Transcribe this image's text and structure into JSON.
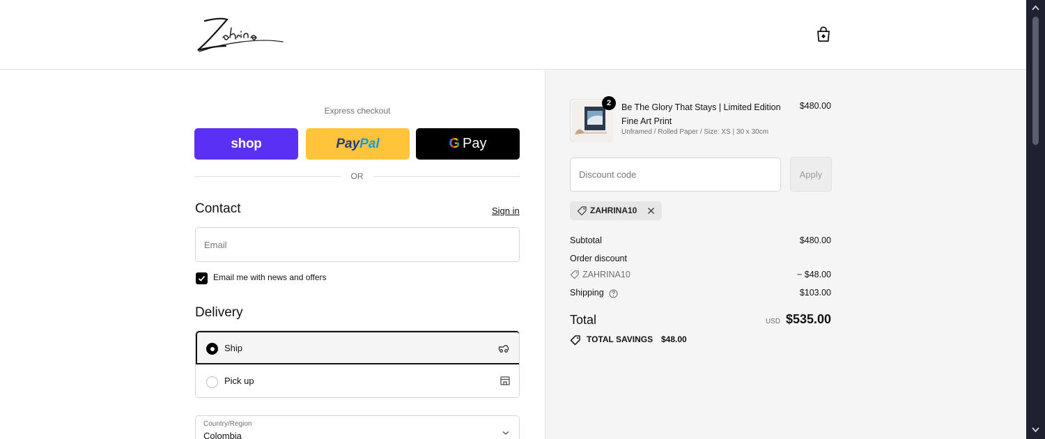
{
  "brand": {
    "logo_text": "Zahrina"
  },
  "header": {
    "cart_icon": "shopping-bag-icon"
  },
  "express": {
    "title": "Express checkout",
    "shop_label": "shop",
    "paypal_label_a": "Pay",
    "paypal_label_b": "Pal",
    "gpay_label_g": "G",
    "gpay_label": "Pay",
    "divider_text": "OR"
  },
  "contact": {
    "title": "Contact",
    "signin_label": "Sign in",
    "email_placeholder": "Email",
    "email_value": "",
    "newsletter_label": "Email me with news and offers",
    "newsletter_checked": true
  },
  "delivery": {
    "title": "Delivery",
    "options": [
      {
        "label": "Ship",
        "selected": true,
        "icon": "truck-icon"
      },
      {
        "label": "Pick up",
        "selected": false,
        "icon": "store-icon"
      }
    ],
    "country_label": "Country/Region",
    "country_value": "Colombia"
  },
  "summary": {
    "product": {
      "quantity": "2",
      "name": "Be The Glory That Stays | Limited Edition Fine Art Print",
      "variant": "Unframed / Rolled Paper / Size: XS | 30 x 30cm",
      "price": "$480.00"
    },
    "discount_placeholder": "Discount code",
    "apply_label": "Apply",
    "applied_code": "ZAHRINA10",
    "subtotal_label": "Subtotal",
    "subtotal_value": "$480.00",
    "order_discount_label": "Order discount",
    "discount_code": "ZAHRINA10",
    "discount_value": "− $48.00",
    "shipping_label": "Shipping",
    "shipping_value": "$103.00",
    "total_label": "Total",
    "total_currency": "USD",
    "total_value": "$535.00",
    "savings_label": "TOTAL SAVINGS",
    "savings_value": "$48.00"
  },
  "colors": {
    "shop_purple": "#5a31f4",
    "paypal_yellow": "#ffc439",
    "gpay_black": "#000000",
    "summary_bg": "#f5f5f5",
    "scrollbar_bg": "#1f2130"
  }
}
